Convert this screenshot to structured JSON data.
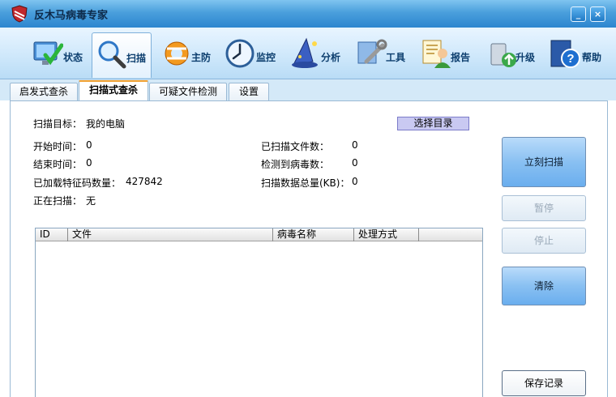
{
  "window": {
    "title": "反木马病毒专家",
    "minimize_label": "_",
    "close_label": "×"
  },
  "toolbar": {
    "items": [
      {
        "label": "状态",
        "icon": "monitor-check-icon"
      },
      {
        "label": "扫描",
        "icon": "magnifier-icon",
        "active": true
      },
      {
        "label": "主防",
        "icon": "lifebuoy-icon"
      },
      {
        "label": "监控",
        "icon": "clock-icon"
      },
      {
        "label": "分析",
        "icon": "wizard-hat-icon"
      },
      {
        "label": "工具",
        "icon": "tools-icon"
      },
      {
        "label": "报告",
        "icon": "report-person-icon"
      },
      {
        "label": "升级",
        "icon": "upgrade-icon"
      },
      {
        "label": "帮助",
        "icon": "help-book-icon"
      }
    ]
  },
  "subtabs": [
    {
      "label": "启发式查杀"
    },
    {
      "label": "扫描式查杀",
      "active": true
    },
    {
      "label": "可疑文件检测"
    },
    {
      "label": "设置"
    }
  ],
  "scan": {
    "target_label": "扫描目标：",
    "target_value": "我的电脑",
    "choose_dir_label": "选择目录",
    "start_time_label": "开始时间：",
    "start_time_value": "0",
    "end_time_label": "结束时间：",
    "end_time_value": "0",
    "signatures_label": "已加载特征码数量：",
    "signatures_value": "427842",
    "scanning_label": "正在扫描：",
    "scanning_value": "无",
    "scanned_files_label": "已扫描文件数：",
    "scanned_files_value": "0",
    "viruses_found_label": "检测到病毒数：",
    "viruses_found_value": "0",
    "data_total_label": "扫描数据总量(KB)：",
    "data_total_value": "0"
  },
  "table": {
    "columns": [
      "ID",
      "文件",
      "病毒名称",
      "处理方式"
    ],
    "rows": []
  },
  "buttons": {
    "scan_now": "立刻扫描",
    "pause": "暂停",
    "stop": "停止",
    "clear": "清除",
    "save_log": "保存记录"
  },
  "colors": {
    "titlebar": "#4a9fdc",
    "toolbar_label": "#0c3e6e",
    "primary_button": "#89c0f2",
    "choose_dir_button": "#c9c9f2",
    "active_tab_accent": "#f0a030"
  }
}
